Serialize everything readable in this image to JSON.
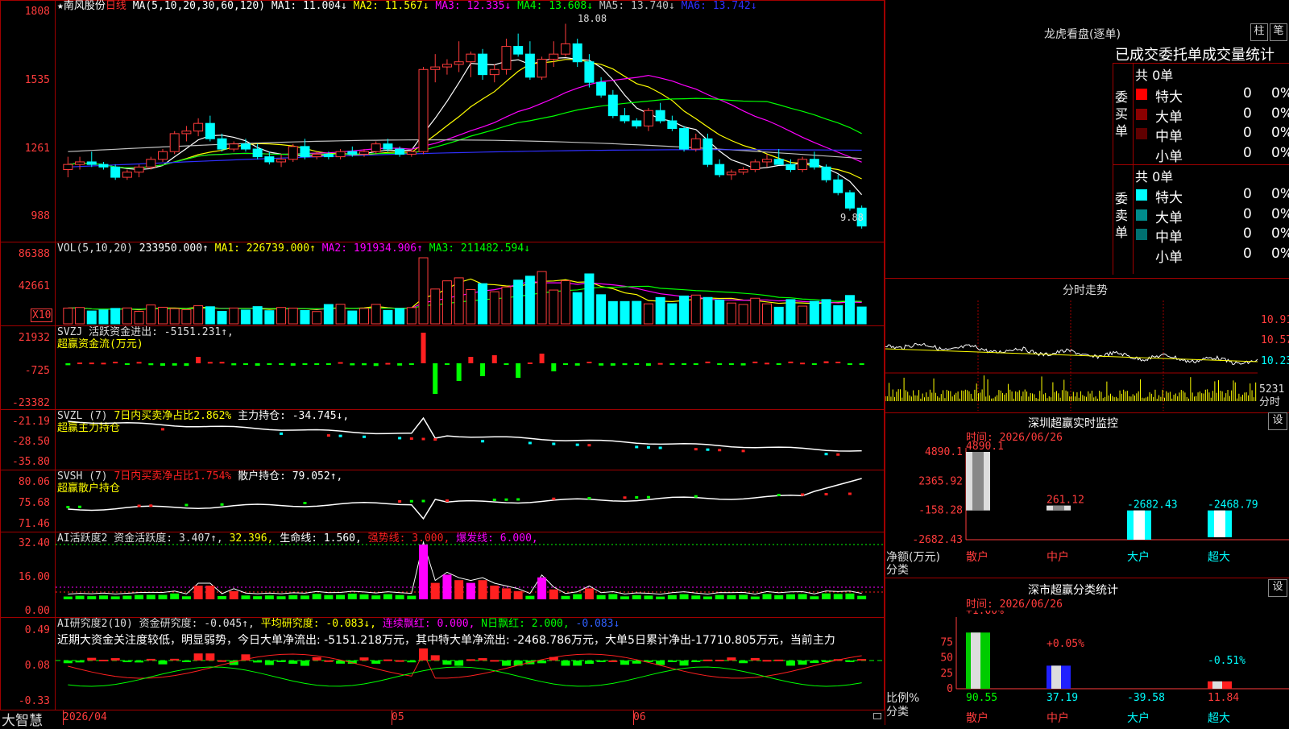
{
  "header": {
    "star": "★",
    "stock": "南风股份",
    "period": "日线",
    "ma_label": "MA(5,10,20,30,60,120)",
    "ma_items": [
      {
        "text": "MA1: 11.004↓",
        "color": "#ffffff"
      },
      {
        "text": "MA2: 11.567↓",
        "color": "#ffff00"
      },
      {
        "text": "MA3: 12.335↓",
        "color": "#ff00ff"
      },
      {
        "text": "MA4: 13.608↓",
        "color": "#00ff00"
      },
      {
        "text": "MA5: 13.740↓",
        "color": "#c0c0c0"
      },
      {
        "text": "MA6: 13.742↓",
        "color": "#3030ff"
      }
    ],
    "high_mark": "18.08",
    "low_mark": "9.88"
  },
  "main_axis": [
    "1808",
    "1535",
    "1261",
    "988"
  ],
  "vol": {
    "label": "VOL(5,10,20)",
    "items": [
      {
        "text": "233950.000↑",
        "color": "#ffffff"
      },
      {
        "text": "MA1: 226739.000↑",
        "color": "#ffff00"
      },
      {
        "text": "MA2: 191934.906↑",
        "color": "#ff00ff"
      },
      {
        "text": "MA3: 211482.594↓",
        "color": "#00ff00"
      }
    ],
    "axis": [
      "86388",
      "42661"
    ],
    "unit": "X10"
  },
  "svzj": {
    "label": "SVZJ  活跃资金进出: -5151.231↑,",
    "sub": "超赢资金流(万元)",
    "axis": [
      "21932",
      "-725",
      "-23382"
    ]
  },
  "svzl": {
    "label": "SVZL (7)",
    "l2": "7日内买卖净占比2.862%",
    "l3": "主力持仓: -34.745↓,",
    "sub": "超赢主力持仓",
    "axis": [
      "-21.19",
      "-28.50",
      "-35.80"
    ]
  },
  "svsh": {
    "label": "SVSH (7)",
    "l2": "7日内买卖净占比1.754%",
    "l3": "散户持仓: 79.052↑,",
    "sub": "超赢散户持仓",
    "axis": [
      "80.06",
      "75.68",
      "71.46"
    ]
  },
  "ai1": {
    "label": "AI活跃度2 资金活跃度: 3.407↑,",
    "items": [
      {
        "text": "32.396,",
        "color": "#ffff00"
      },
      {
        "text": "生命线: 1.560,",
        "color": "#ffffff"
      },
      {
        "text": "强势线: 3.000,",
        "color": "#ff2020"
      },
      {
        "text": "爆发线: 6.000,",
        "color": "#ff00ff"
      }
    ],
    "axis": [
      "32.40",
      "16.00",
      "0.00"
    ]
  },
  "ai2": {
    "label": "AI研究度2(10) 资金研究度: -0.045↑,",
    "items": [
      {
        "text": "平均研究度: -0.083↓,",
        "color": "#ffff00"
      },
      {
        "text": "连续飘红: 0.000,",
        "color": "#ff00ff"
      },
      {
        "text": "N日飘红: 2.000,",
        "color": "#00ff00"
      },
      {
        "text": "-0.083↓",
        "color": "#3060ff"
      }
    ],
    "note": "近期大资金关注度较低，明显弱势，今日大单净流出: -5151.218万元，其中特大单净流出: -2468.786万元，大单5日累计净出-17710.805万元，当前主力",
    "axis": [
      "0.49",
      "0.08",
      "-0.33"
    ]
  },
  "footer": {
    "brand": "大智慧",
    "dates": [
      "2026/04",
      "05",
      "06"
    ]
  },
  "lhb": {
    "title": "龙虎看盘(逐单)",
    "btn1": "柱",
    "btn2": "笔",
    "subtitle": "已成交委托单成交量统计",
    "buy_total": "共 0单",
    "buy_label": "委买单",
    "sell_total": "共 0单",
    "sell_label": "委卖单",
    "buy_rows": [
      {
        "name": "特大",
        "val": "0",
        "pct": "0%",
        "color": "#ff0000"
      },
      {
        "name": "大单",
        "val": "0",
        "pct": "0%",
        "color": "#8b0000"
      },
      {
        "name": "中单",
        "val": "0",
        "pct": "0%",
        "color": "#600000"
      },
      {
        "name": "小单",
        "val": "0",
        "pct": "0%",
        "color": ""
      }
    ],
    "sell_rows": [
      {
        "name": "特大",
        "val": "0",
        "pct": "0%",
        "color": "#00ffff"
      },
      {
        "name": "大单",
        "val": "0",
        "pct": "0%",
        "color": "#008b8b"
      },
      {
        "name": "中单",
        "val": "0",
        "pct": "0%",
        "color": "#007070"
      },
      {
        "name": "小单",
        "val": "0",
        "pct": "0%",
        "color": ""
      }
    ]
  },
  "fs": {
    "title": "分时走势",
    "axis": [
      "10.91",
      "10.57",
      "10.23"
    ],
    "vol": "5231",
    "unit": "分时"
  },
  "sz_monitor": {
    "title": "深圳超赢实时监控",
    "btn": "设",
    "time": "时间: 2026/06/26",
    "axis": [
      "4890.1",
      "2365.92",
      "-158.28",
      "-2682.43"
    ],
    "ylabel": "净额(万元)",
    "xlabel": "分类",
    "values": [
      "4890.1",
      "261.12",
      "-2682.43",
      "-2468.79"
    ],
    "cats": [
      "散户",
      "中户",
      "大户",
      "超大"
    ]
  },
  "sz_class": {
    "title": "深市超赢分类统计",
    "btn": "设",
    "time": "时间: 2026/06/26",
    "axis": [
      "75",
      "50",
      "25",
      "0"
    ],
    "ylabel": "比例%",
    "xlabel": "分类",
    "pcts": [
      "+1.00%",
      "+0.05%",
      "-0.51%"
    ],
    "values": [
      "90.55",
      "37.19",
      "-39.58",
      "11.84"
    ],
    "cats": [
      "散户",
      "中户",
      "大户",
      "超大"
    ]
  },
  "chart_data": [
    {
      "type": "candlestick",
      "title": "南风股份 日线",
      "ylim": [
        9.88,
        18.08
      ],
      "x": [
        "2026/04",
        "05",
        "06"
      ],
      "series": [
        {
          "name": "K",
          "ohlc": [
            [
              12.4,
              12.9,
              12.1,
              12.6
            ],
            [
              12.6,
              12.9,
              12.4,
              12.7
            ],
            [
              12.7,
              13.1,
              12.5,
              12.6
            ],
            [
              12.6,
              12.7,
              12.4,
              12.5
            ],
            [
              12.5,
              12.6,
              12.0,
              12.1
            ],
            [
              12.1,
              12.4,
              12.0,
              12.3
            ],
            [
              12.3,
              12.6,
              12.1,
              12.5
            ],
            [
              12.5,
              12.9,
              12.4,
              12.8
            ],
            [
              12.8,
              13.2,
              12.7,
              13.1
            ],
            [
              13.1,
              13.9,
              13.0,
              13.8
            ],
            [
              13.8,
              14.1,
              13.5,
              13.9
            ],
            [
              13.9,
              14.4,
              13.7,
              14.2
            ],
            [
              14.2,
              14.5,
              13.5,
              13.6
            ],
            [
              13.6,
              13.8,
              13.1,
              13.2
            ],
            [
              13.2,
              13.5,
              13.1,
              13.4
            ],
            [
              13.4,
              13.6,
              13.1,
              13.2
            ],
            [
              13.2,
              13.4,
              12.8,
              12.9
            ],
            [
              12.9,
              13.1,
              12.6,
              12.7
            ],
            [
              12.7,
              13.0,
              12.5,
              12.8
            ],
            [
              12.8,
              13.4,
              12.7,
              13.3
            ],
            [
              13.3,
              13.6,
              12.8,
              12.9
            ],
            [
              12.9,
              13.1,
              12.8,
              13.0
            ],
            [
              13.0,
              13.1,
              12.8,
              12.9
            ],
            [
              12.9,
              13.2,
              12.8,
              13.1
            ],
            [
              13.1,
              13.3,
              12.9,
              13.0
            ],
            [
              13.0,
              13.2,
              12.9,
              13.1
            ],
            [
              13.1,
              13.5,
              13.0,
              13.4
            ],
            [
              13.4,
              13.6,
              13.1,
              13.2
            ],
            [
              13.2,
              13.3,
              12.9,
              13.0
            ],
            [
              13.0,
              13.2,
              12.9,
              13.1
            ],
            [
              13.1,
              16.4,
              13.0,
              16.3
            ],
            [
              16.3,
              16.9,
              15.8,
              16.4
            ],
            [
              16.4,
              16.7,
              16.1,
              16.5
            ],
            [
              16.5,
              17.4,
              16.2,
              16.6
            ],
            [
              16.6,
              17.0,
              16.0,
              16.9
            ],
            [
              16.9,
              17.1,
              15.9,
              16.1
            ],
            [
              16.1,
              16.5,
              15.8,
              16.3
            ],
            [
              16.3,
              17.5,
              16.1,
              17.2
            ],
            [
              17.2,
              17.7,
              16.8,
              16.9
            ],
            [
              16.9,
              17.4,
              15.9,
              16.0
            ],
            [
              16.0,
              16.8,
              15.9,
              16.7
            ],
            [
              16.7,
              17.4,
              16.4,
              16.9
            ],
            [
              16.9,
              18.08,
              16.8,
              17.3
            ],
            [
              17.3,
              17.5,
              16.4,
              16.6
            ],
            [
              16.6,
              16.9,
              15.6,
              15.8
            ],
            [
              15.8,
              16.0,
              15.2,
              15.3
            ],
            [
              15.3,
              15.5,
              14.4,
              14.5
            ],
            [
              14.5,
              14.8,
              14.2,
              14.3
            ],
            [
              14.3,
              14.4,
              14.0,
              14.1
            ],
            [
              14.1,
              14.8,
              13.9,
              14.7
            ],
            [
              14.7,
              15.0,
              14.2,
              14.3
            ],
            [
              14.3,
              14.5,
              13.9,
              14.0
            ],
            [
              14.0,
              14.1,
              13.1,
              13.2
            ],
            [
              13.2,
              13.8,
              13.1,
              13.6
            ],
            [
              13.6,
              13.8,
              12.5,
              12.6
            ],
            [
              12.6,
              12.8,
              12.1,
              12.2
            ],
            [
              12.2,
              12.4,
              12.0,
              12.3
            ],
            [
              12.3,
              12.5,
              12.2,
              12.4
            ],
            [
              12.4,
              12.8,
              12.3,
              12.7
            ],
            [
              12.7,
              13.0,
              12.5,
              12.8
            ],
            [
              12.8,
              13.2,
              12.6,
              12.6
            ],
            [
              12.6,
              12.8,
              12.3,
              12.4
            ],
            [
              12.4,
              12.9,
              12.3,
              12.8
            ],
            [
              12.8,
              13.1,
              12.4,
              12.5
            ],
            [
              12.5,
              12.6,
              11.9,
              12.0
            ],
            [
              12.0,
              12.2,
              11.4,
              11.5
            ],
            [
              11.5,
              11.6,
              10.8,
              10.9
            ],
            [
              10.9,
              11.0,
              10.1,
              10.2
            ]
          ]
        }
      ]
    },
    {
      "type": "bar",
      "title": "深圳超赢实时监控",
      "categories": [
        "散户",
        "中户",
        "大户",
        "超大"
      ],
      "values": [
        4890.1,
        261.12,
        -2682.43,
        -2468.79
      ],
      "ylabel": "净额(万元)",
      "ylim": [
        -2682.43,
        4890.1
      ]
    },
    {
      "type": "bar",
      "title": "深市超赢分类统计",
      "categories": [
        "散户",
        "中户",
        "大户",
        "超大"
      ],
      "values": [
        90.55,
        37.19,
        -39.58,
        11.84
      ],
      "ylabel": "比例%",
      "ylim": [
        0,
        75
      ]
    }
  ]
}
